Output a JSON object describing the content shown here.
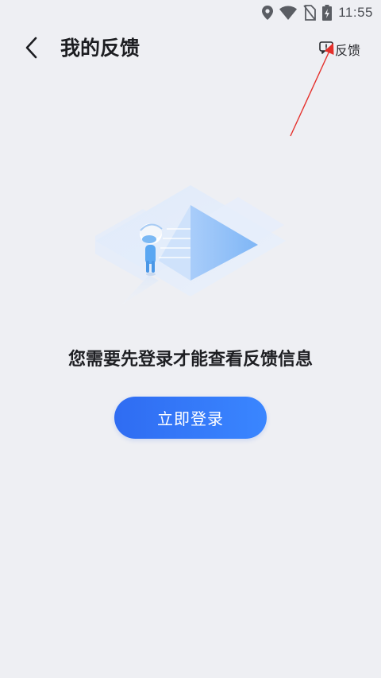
{
  "status_bar": {
    "time": "11:55",
    "icons": [
      "location-icon",
      "wifi-icon",
      "no-sim-icon",
      "battery-charging-icon"
    ]
  },
  "header": {
    "back_icon": "chevron-left-icon",
    "title": "我的反馈",
    "feedback_icon": "feedback-icon",
    "feedback_label": "反馈"
  },
  "main": {
    "illustration": "empty-state-illustration",
    "message": "您需要先登录才能查看反馈信息",
    "login_button_label": "立即登录"
  },
  "colors": {
    "background": "#eeeff3",
    "accent": "#2f6cf2",
    "annotation": "#e5302b"
  }
}
